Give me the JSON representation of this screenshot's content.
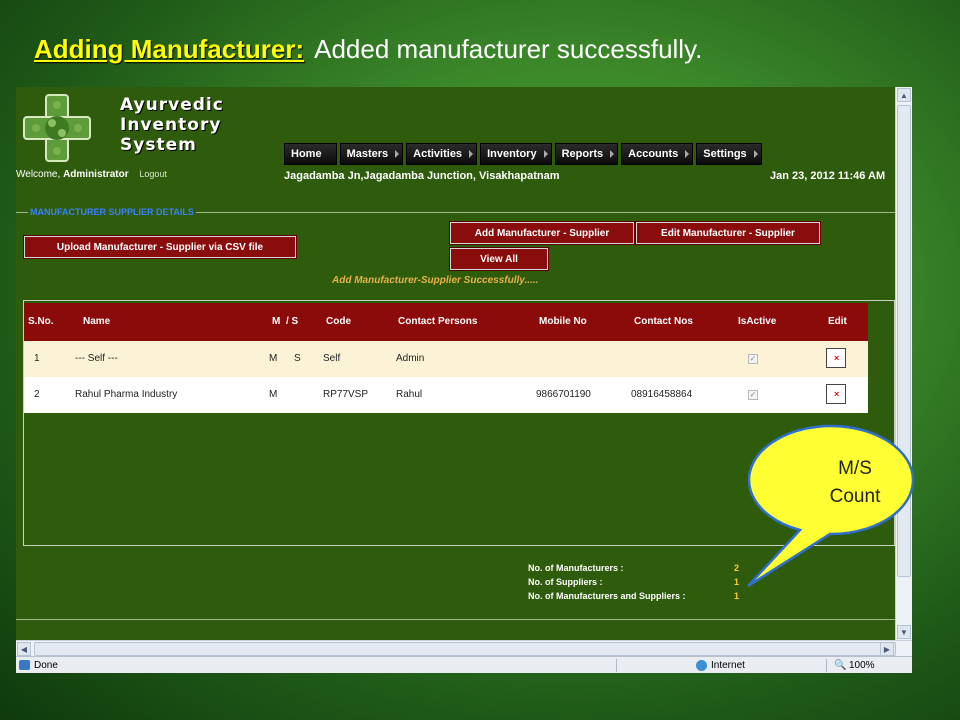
{
  "slide": {
    "title_highlight": "Adding Manufacturer:",
    "title_rest": "Added manufacturer successfully."
  },
  "app": {
    "logo_lines": [
      "Ayurvedic",
      "Inventory",
      "System"
    ],
    "welcome_prefix": "Welcome,",
    "user": "Administrator",
    "logout": "Logout",
    "location": "Jagadamba Jn,Jagadamba Junction, Visakhapatnam",
    "datetime": "Jan 23, 2012 11:46 AM"
  },
  "nav": [
    "Home",
    "Masters",
    "Activities",
    "Inventory",
    "Reports",
    "Accounts",
    "Settings"
  ],
  "section": {
    "legend": "MANUFACTURER SUPPLIER DETAILS",
    "upload_button": "Upload Manufacturer - Supplier via CSV file",
    "add_button": "Add Manufacturer - Supplier",
    "edit_button": "Edit Manufacturer - Supplier",
    "view_all_button": "View All",
    "message": "Add Manufacturer-Supplier Successfully....."
  },
  "table": {
    "headers": [
      "S.No.",
      "Name",
      "M",
      "/ S",
      "Code",
      "Contact Persons",
      "Mobile No",
      "Contact Nos",
      "IsActive",
      "Edit"
    ],
    "rows": [
      {
        "sno": "1",
        "name": "--- Self ---",
        "m": "M",
        "s": "S",
        "code": "Self",
        "contact": "Admin",
        "mobile": "",
        "contact_nos": "",
        "active": true
      },
      {
        "sno": "2",
        "name": "Rahul Pharma Industry",
        "m": "M",
        "s": "",
        "code": "RP77VSP",
        "contact": "Rahul",
        "mobile": "9866701190",
        "contact_nos": "08916458864",
        "active": true
      }
    ]
  },
  "counts": [
    {
      "label": "No. of Manufacturers :",
      "value": "2"
    },
    {
      "label": "No. of Suppliers :",
      "value": "1"
    },
    {
      "label": "No. of Manufacturers and Suppliers :",
      "value": "1"
    }
  ],
  "callout": {
    "line1": "M/S",
    "line2": "Count"
  },
  "statusbar": {
    "status": "Done",
    "zone": "Internet",
    "zoom": "100%"
  },
  "colors": {
    "header_red": "#8b0a0a",
    "page_green": "#2e5b0c",
    "callout_yellow": "#ffff33",
    "title_yellow": "#ffff00"
  }
}
